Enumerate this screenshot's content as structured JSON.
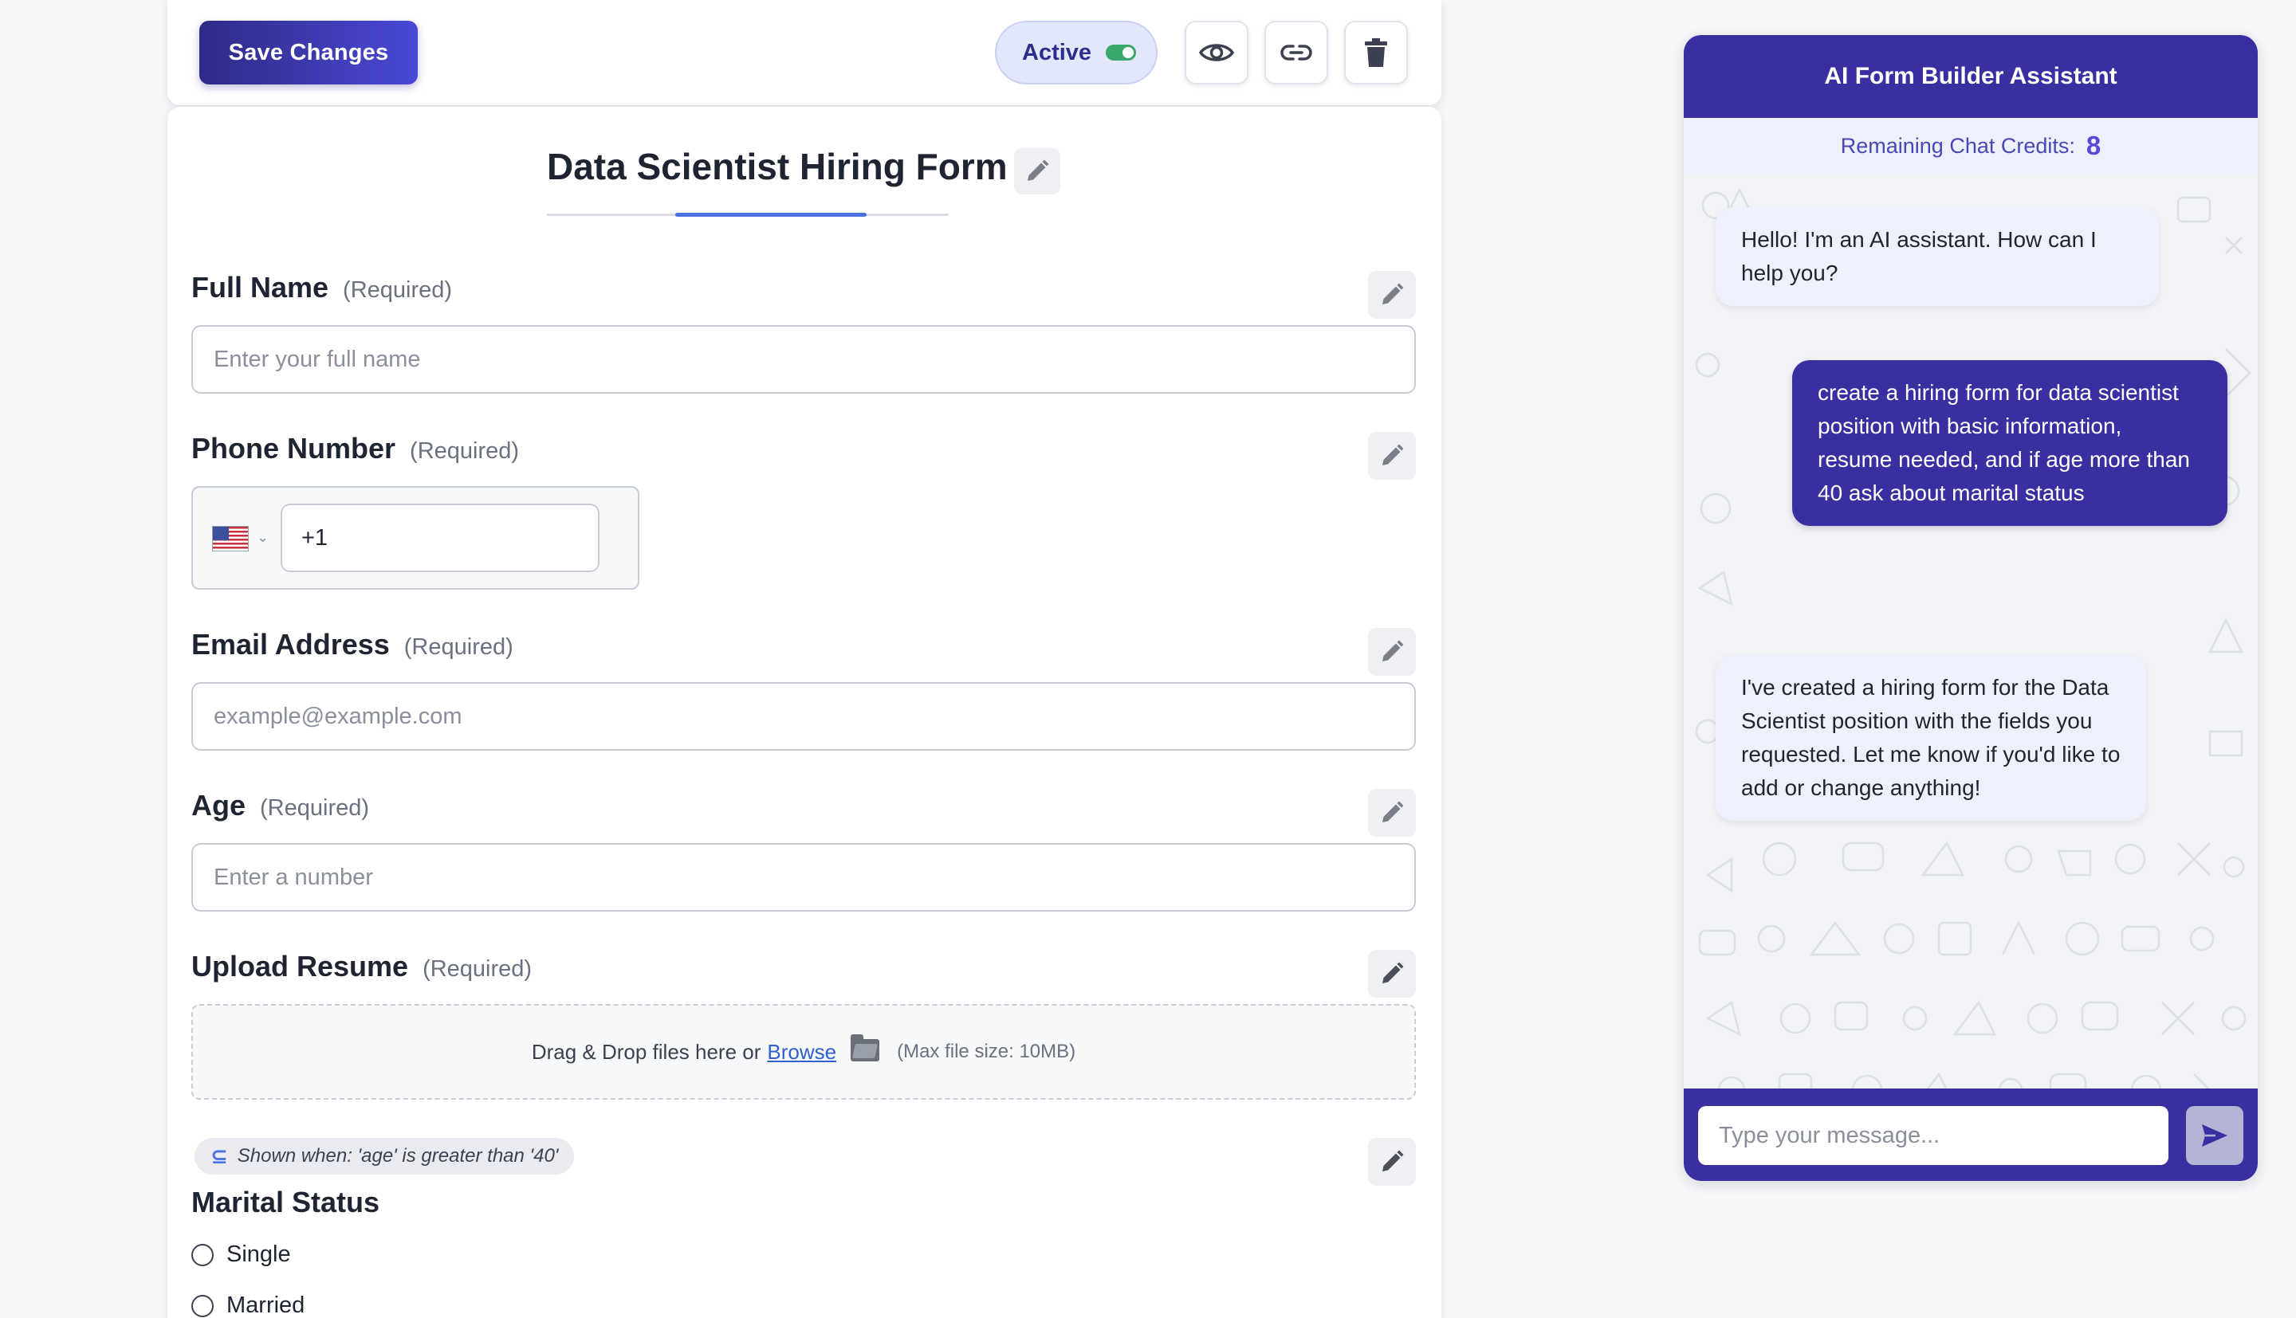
{
  "toolbar": {
    "save_label": "Save Changes",
    "status_label": "Active",
    "status_on": true,
    "preview_icon": "eye-icon",
    "link_icon": "link-icon",
    "delete_icon": "trash-icon"
  },
  "form": {
    "title": "Data Scientist Hiring Form",
    "fields": [
      {
        "label": "Full Name",
        "required_text": "(Required)",
        "placeholder": "Enter your full name"
      },
      {
        "label": "Phone Number",
        "required_text": "(Required)",
        "value": "+1",
        "country": "US"
      },
      {
        "label": "Email Address",
        "required_text": "(Required)",
        "placeholder": "example@example.com"
      },
      {
        "label": "Age",
        "required_text": "(Required)",
        "placeholder": "Enter a number"
      },
      {
        "label": "Upload Resume",
        "required_text": "(Required)"
      }
    ],
    "upload": {
      "text": "Drag & Drop files here or",
      "browse": "Browse",
      "max_size": "(Max file size: 10MB)"
    },
    "conditional": {
      "text": "Shown when: 'age' is greater than '40'",
      "field_label": "Marital Status",
      "options": [
        "Single",
        "Married"
      ]
    }
  },
  "chat": {
    "title": "AI Form Builder Assistant",
    "credits_label": "Remaining Chat Credits:",
    "credits_value": "8",
    "messages": [
      {
        "role": "assistant",
        "text": "Hello! I'm an AI assistant. How can I help you?"
      },
      {
        "role": "user",
        "text": "create a hiring form for data scientist position with basic information, resume needed, and if age more than 40 ask about marital status"
      },
      {
        "role": "assistant",
        "text": "I've created a hiring form for the Data Scientist position with the fields you requested. Let me know if you'd like to add or change anything!"
      }
    ],
    "input_placeholder": "Type your message...",
    "send_icon": "send-icon"
  },
  "colors": {
    "primary": "#3a2fa0",
    "accent": "#4b72e0",
    "toggle_on": "#3aa76d"
  }
}
